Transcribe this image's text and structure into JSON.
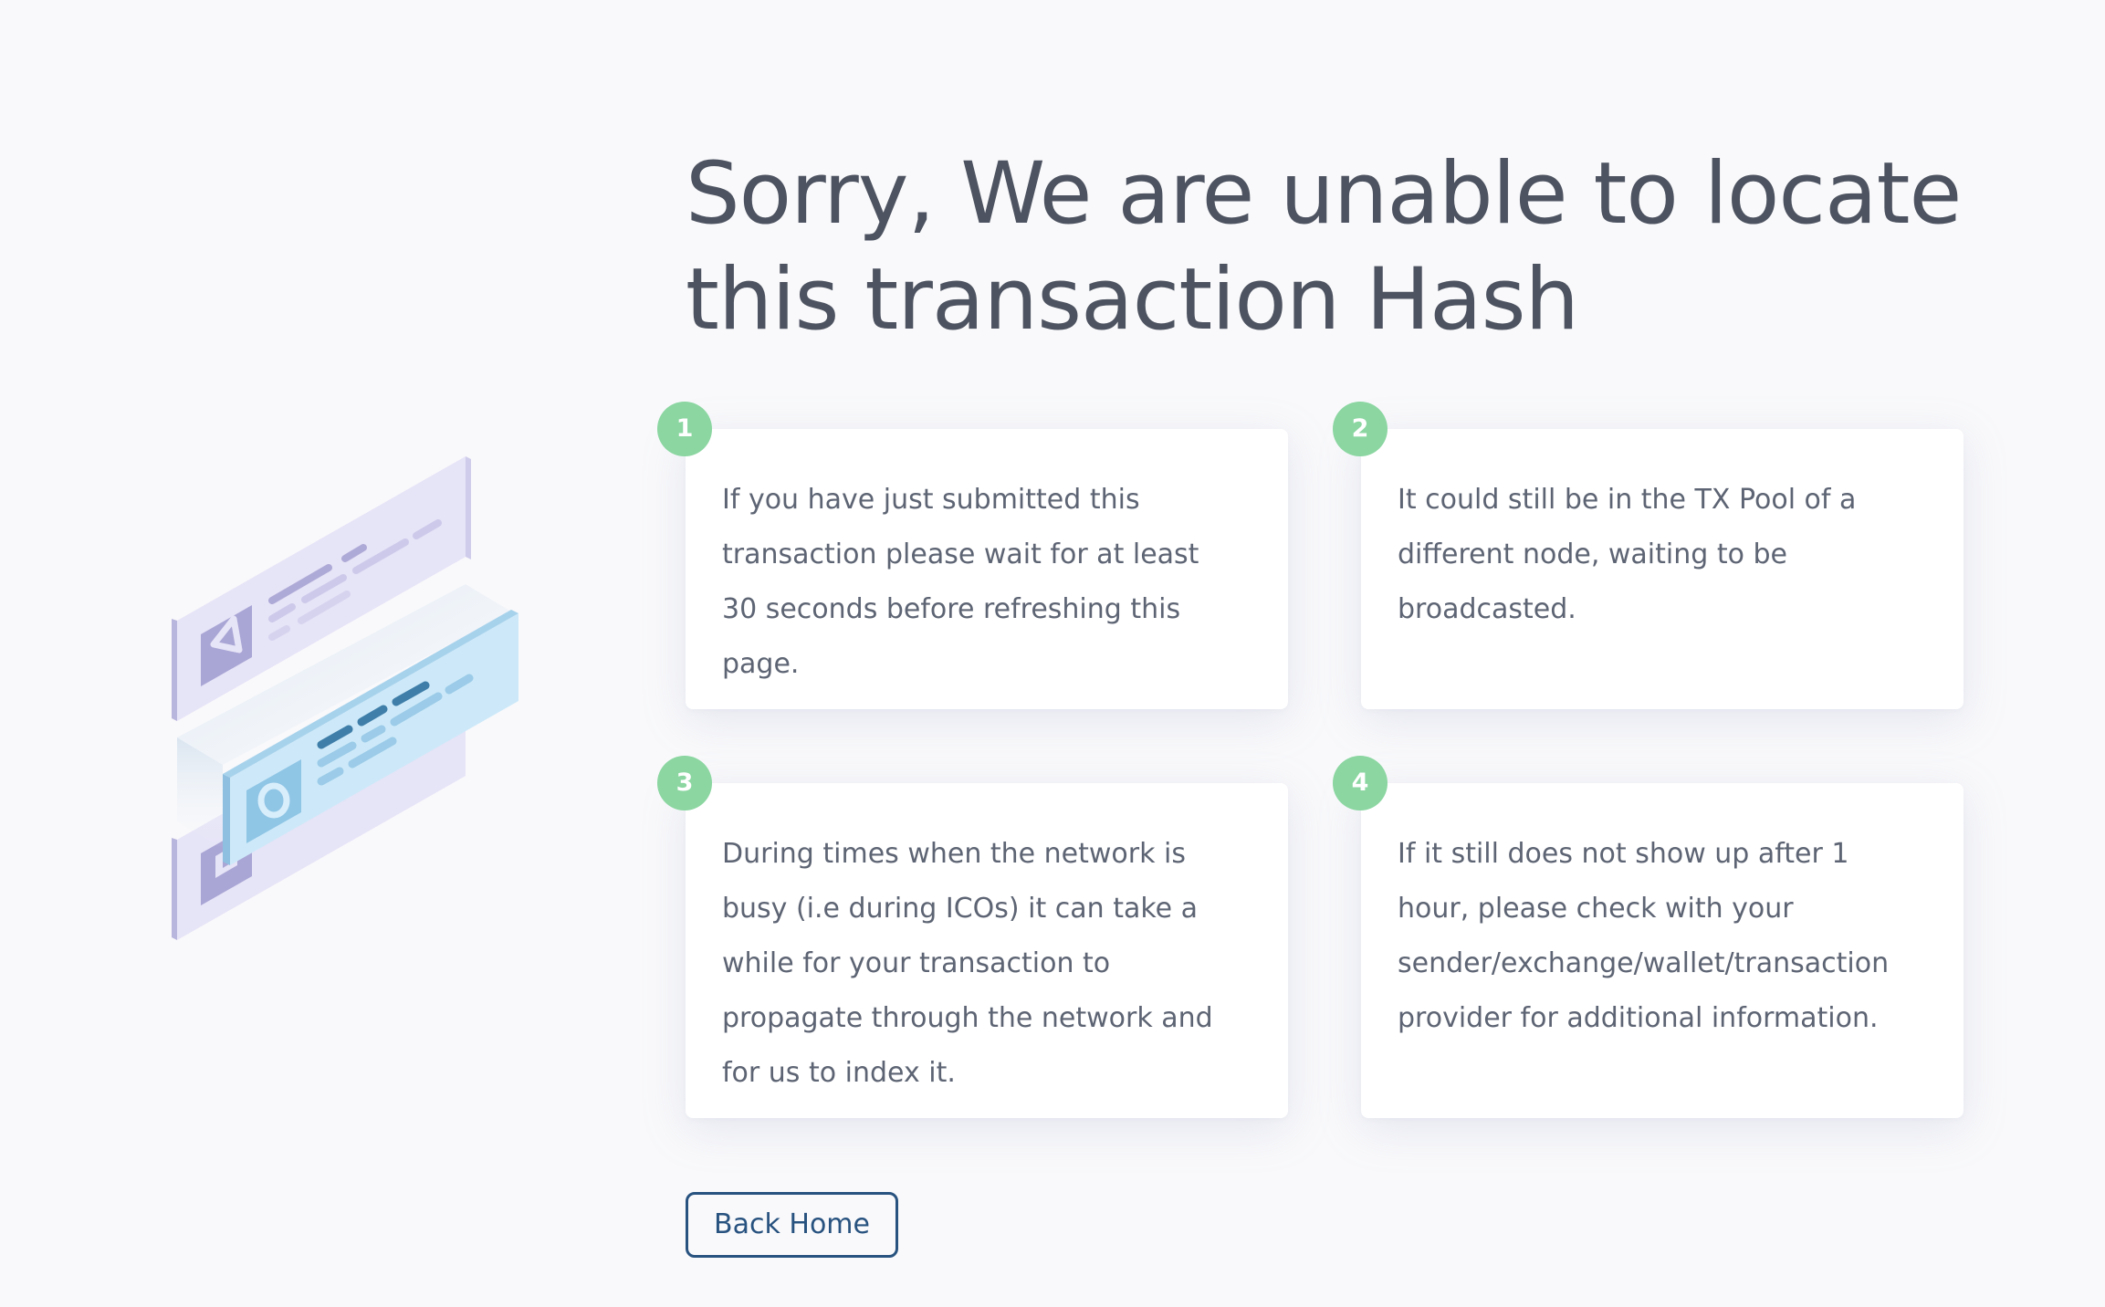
{
  "page": {
    "headline": "Sorry, We are unable to locate this transaction Hash"
  },
  "cards": [
    {
      "number": "1",
      "text": "If you have just submitted this transaction please wait for at least 30 seconds before refreshing this page."
    },
    {
      "number": "2",
      "text": "It could still be in the TX Pool of a different node, waiting to be broadcasted."
    },
    {
      "number": "3",
      "text": "During times when the network is busy (i.e during ICOs) it can take a while for your transaction to propagate through the network and for us to index it."
    },
    {
      "number": "4",
      "text": "If it still does not show up after 1 hour, please check with your sender/exchange/wallet/transaction provider for additional information."
    }
  ],
  "actions": {
    "back_home_label": "Back Home"
  },
  "illustration": {
    "icon": "stacked-transaction-cards-icon"
  },
  "colors": {
    "background": "#f9f9fb",
    "headline": "#4d5360",
    "body_text": "#5d6473",
    "badge": "#8bd6a1",
    "button": "#28527f"
  }
}
